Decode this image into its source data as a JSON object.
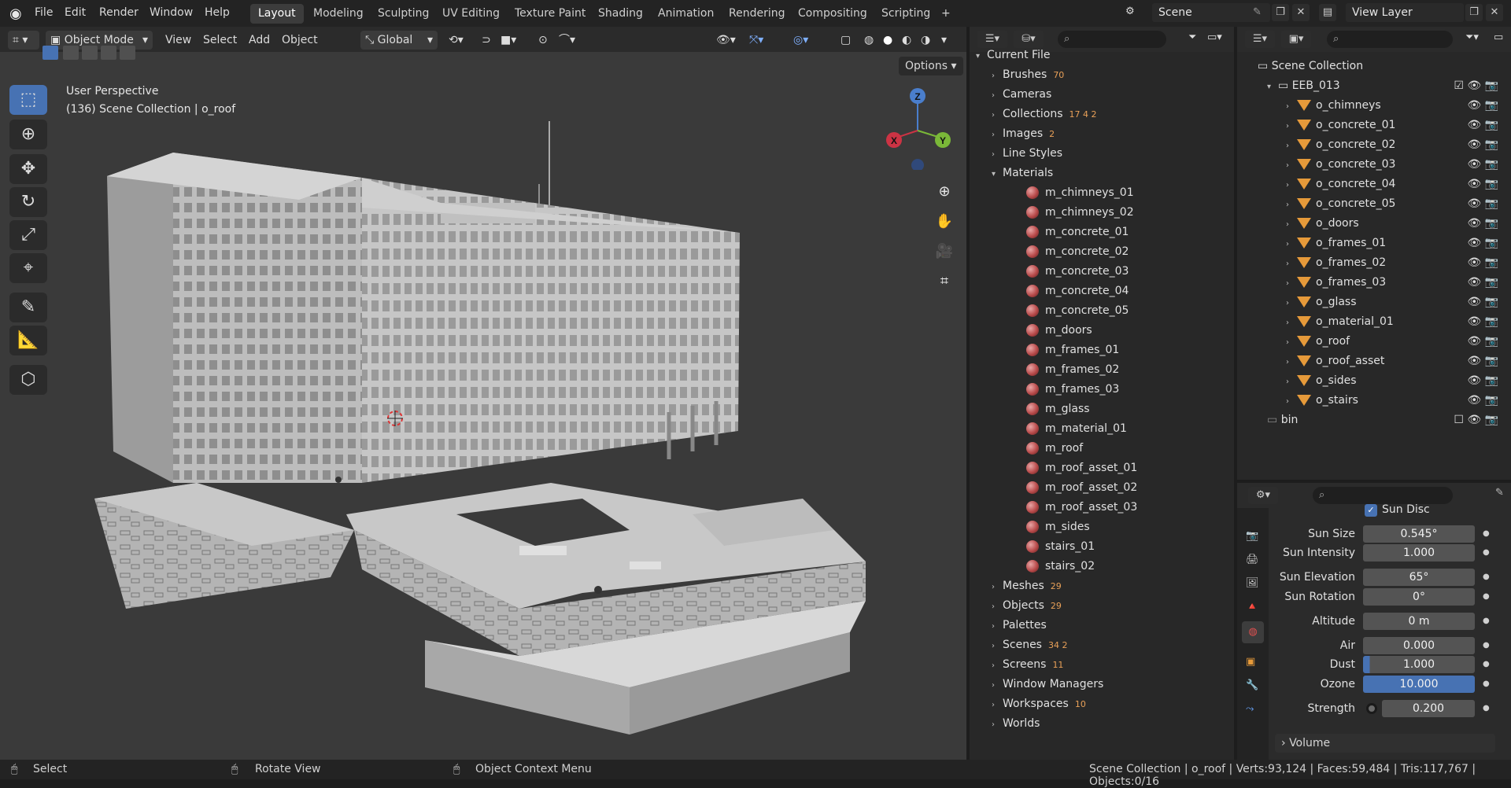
{
  "topbar": {
    "menus": [
      "File",
      "Edit",
      "Render",
      "Window",
      "Help"
    ],
    "workspaces": [
      "Layout",
      "Modeling",
      "Sculpting",
      "UV Editing",
      "Texture Paint",
      "Shading",
      "Animation",
      "Rendering",
      "Compositing",
      "Scripting"
    ],
    "active_workspace": "Layout",
    "add_tab": "+",
    "scene_value": "Scene",
    "view_layer_value": "View Layer"
  },
  "viewport": {
    "mode": "Object Mode",
    "menus": [
      "View",
      "Select",
      "Add",
      "Object"
    ],
    "orientation": "Global",
    "options_label": "Options",
    "perspective_label": "User Perspective",
    "collection_label": "(136) Scene Collection | o_roof",
    "axis_x": "X",
    "axis_y": "Y",
    "axis_z": "Z",
    "accent": "#4772b3"
  },
  "outliner_file": {
    "root": "Current File",
    "categories": [
      {
        "label": "Brushes",
        "count": "70"
      },
      {
        "label": "Cameras",
        "count": ""
      },
      {
        "label": "Collections",
        "count": "17 4 2"
      },
      {
        "label": "Images",
        "count": "2"
      },
      {
        "label": "Line Styles",
        "count": ""
      },
      {
        "label": "Materials",
        "count": ""
      }
    ],
    "materials": [
      "m_chimneys_01",
      "m_chimneys_02",
      "m_concrete_01",
      "m_concrete_02",
      "m_concrete_03",
      "m_concrete_04",
      "m_concrete_05",
      "m_doors",
      "m_frames_01",
      "m_frames_02",
      "m_frames_03",
      "m_glass",
      "m_material_01",
      "m_roof",
      "m_roof_asset_01",
      "m_roof_asset_02",
      "m_roof_asset_03",
      "m_sides",
      "stairs_01",
      "stairs_02"
    ],
    "categories_after": [
      {
        "label": "Meshes",
        "count": "29"
      },
      {
        "label": "Objects",
        "count": "29"
      },
      {
        "label": "Palettes",
        "count": ""
      },
      {
        "label": "Scenes",
        "count": "34 2"
      },
      {
        "label": "Screens",
        "count": "11"
      },
      {
        "label": "Window Managers",
        "count": ""
      },
      {
        "label": "Workspaces",
        "count": "10"
      },
      {
        "label": "Worlds",
        "count": ""
      }
    ]
  },
  "outliner_scene": {
    "root": "Scene Collection",
    "collection": "EEB_013",
    "objects": [
      "o_chimneys",
      "o_concrete_01",
      "o_concrete_02",
      "o_concrete_03",
      "o_concrete_04",
      "o_concrete_05",
      "o_doors",
      "o_frames_01",
      "o_frames_02",
      "o_frames_03",
      "o_glass",
      "o_material_01",
      "o_roof",
      "o_roof_asset",
      "o_sides",
      "o_stairs"
    ],
    "bin": "bin"
  },
  "properties": {
    "sun_disc_label": "Sun Disc",
    "rows": [
      {
        "label": "Sun Size",
        "value": "0.545°"
      },
      {
        "label": "Sun Intensity",
        "value": "1.000"
      },
      {
        "label": "Sun Elevation",
        "value": "65°"
      },
      {
        "label": "Sun Rotation",
        "value": "0°"
      },
      {
        "label": "Altitude",
        "value": "0 m"
      },
      {
        "label": "Air",
        "value": "0.000"
      },
      {
        "label": "Dust",
        "value": "1.000"
      },
      {
        "label": "Ozone",
        "value": "10.000"
      },
      {
        "label": "Strength",
        "value": "0.200"
      }
    ],
    "volume_label": "Volume"
  },
  "statusbar": {
    "select": "Select",
    "rotate": "Rotate View",
    "context": "Object Context Menu",
    "stats": "Scene Collection | o_roof | Verts:93,124 | Faces:59,484 | Tris:117,767 | Objects:0/16"
  }
}
